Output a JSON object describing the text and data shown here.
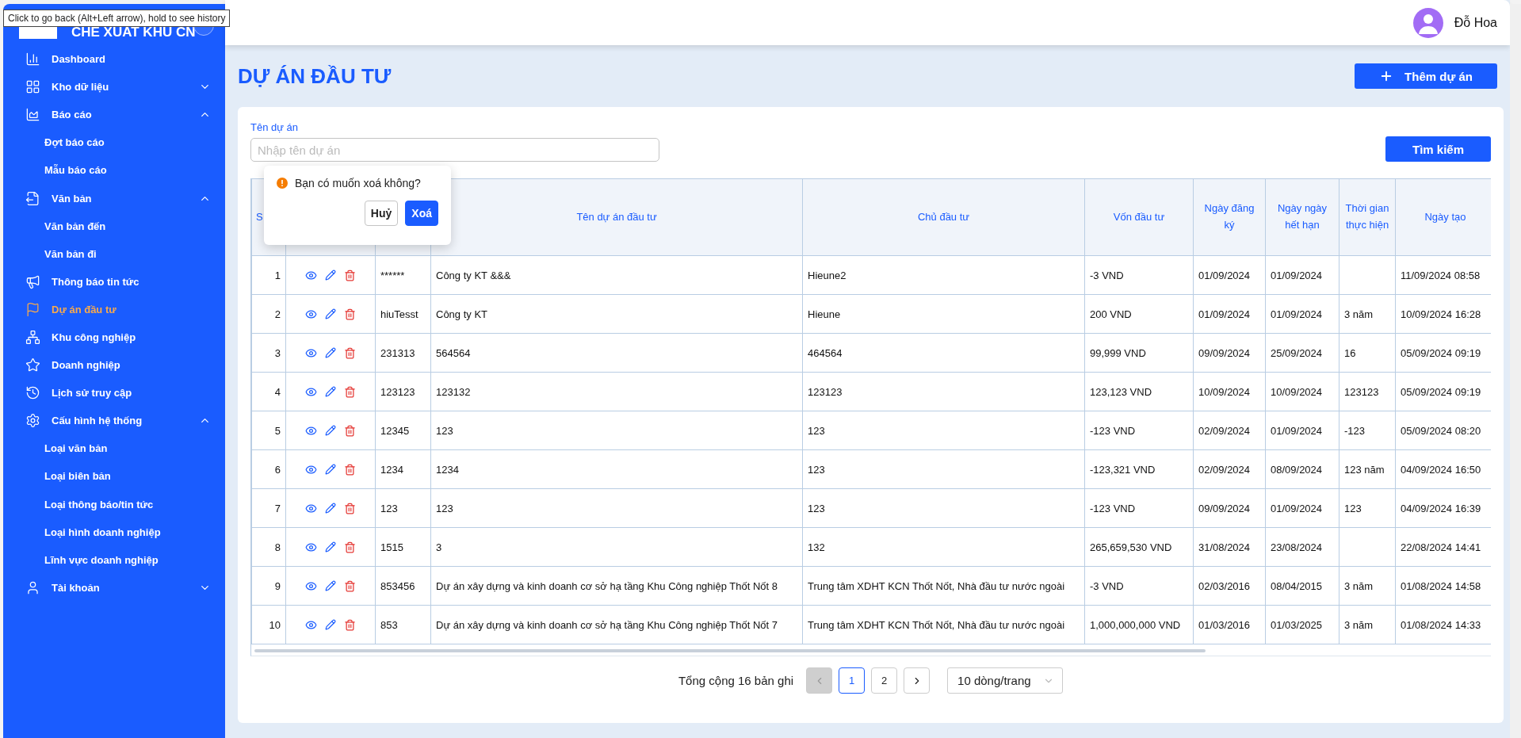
{
  "browser_tooltip": {
    "text": "Click to go back (Alt+Left arrow), hold to see history"
  },
  "sidebar": {
    "logo_text": "CHE XUAT KHU CN",
    "items": [
      {
        "label": "Dashboard",
        "selected": false
      },
      {
        "label": "Kho dữ liệu",
        "selected": false,
        "expanded": false
      },
      {
        "label": "Báo cáo",
        "selected": false,
        "expanded": true,
        "children": [
          {
            "label": "Đợt báo cáo",
            "selected": false
          },
          {
            "label": "Mẫu báo cáo",
            "selected": false
          }
        ]
      },
      {
        "label": "Văn bản",
        "selected": false,
        "expanded": true,
        "children": [
          {
            "label": "Văn bản đến",
            "selected": false
          },
          {
            "label": "Văn bản đi",
            "selected": false
          }
        ]
      },
      {
        "label": "Thông báo tin tức",
        "selected": false
      },
      {
        "label": "Dự án đầu tư",
        "selected": true
      },
      {
        "label": "Khu công nghiệp",
        "selected": false
      },
      {
        "label": "Doanh nghiệp",
        "selected": false
      },
      {
        "label": "Lịch sử truy cập",
        "selected": false
      },
      {
        "label": "Cấu hình hệ thống",
        "selected": false,
        "expanded": true,
        "children": [
          {
            "label": "Loại văn bản",
            "selected": false
          },
          {
            "label": "Loại biên bản",
            "selected": false
          },
          {
            "label": "Loại thông báo/tin tức",
            "selected": false
          },
          {
            "label": "Loại hình doanh nghiệp",
            "selected": false
          },
          {
            "label": "Lĩnh vực doanh nghiệp",
            "selected": false
          }
        ]
      },
      {
        "label": "Tài khoản",
        "selected": false,
        "expanded": false
      }
    ]
  },
  "header": {
    "user_name": "Đỗ Hoa"
  },
  "page": {
    "title": "DỰ ÁN ĐẦU TƯ",
    "add_button": "Thêm dự án"
  },
  "search": {
    "label": "Tên dự án",
    "placeholder": "Nhập tên dự án",
    "button": "Tìm kiếm"
  },
  "table": {
    "columns": [
      {
        "label": "S"
      },
      {},
      {},
      {
        "label": "Tên dự án đầu tư"
      },
      {
        "label": "Chủ đầu tư"
      },
      {
        "label": "Vốn đầu tư"
      },
      {
        "label": "Ngày đăng ký"
      },
      {
        "label": "Ngày ngày hết hạn"
      },
      {
        "label": "Thời gian thực hiện"
      },
      {
        "label": "Ngày tạo"
      }
    ],
    "rows": [
      {
        "stt": "1",
        "code": "******",
        "name": "Công ty KT &&&",
        "owner": "Hieune2",
        "capital": "-3 VND",
        "reg_date": "01/09/2024",
        "exp_date": "01/09/2024",
        "created": "11/09/2024 08:58"
      },
      {
        "stt": "2",
        "code": "hiuTesst",
        "name": "Công ty KT",
        "owner": "Hieune",
        "capital": "200 VND",
        "reg_date": "01/09/2024",
        "exp_date": "01/09/2024",
        "duration": "3 năm",
        "created": "10/09/2024 16:28"
      },
      {
        "stt": "3",
        "code": "231313",
        "name": "564564",
        "owner": "464564",
        "capital": "99,999 VND",
        "reg_date": "09/09/2024",
        "exp_date": "25/09/2024",
        "duration": "16",
        "created": "05/09/2024 09:19"
      },
      {
        "stt": "4",
        "code": "123123",
        "name": "123132",
        "owner": "123123",
        "capital": "123,123 VND",
        "reg_date": "10/09/2024",
        "exp_date": "10/09/2024",
        "duration": "123123",
        "created": "05/09/2024 09:19"
      },
      {
        "stt": "5",
        "code": "12345",
        "name": "123",
        "owner": "123",
        "capital": "-123 VND",
        "reg_date": "02/09/2024",
        "exp_date": "01/09/2024",
        "duration": "-123",
        "created": "05/09/2024 08:20"
      },
      {
        "stt": "6",
        "code": "1234",
        "name": "1234",
        "owner": "123",
        "capital": "-123,321 VND",
        "reg_date": "02/09/2024",
        "exp_date": "08/09/2024",
        "duration": "123 năm",
        "created": "04/09/2024 16:50"
      },
      {
        "stt": "7",
        "code": "123",
        "name": "123",
        "owner": "123",
        "capital": "-123 VND",
        "reg_date": "09/09/2024",
        "exp_date": "01/09/2024",
        "duration": "123",
        "created": "04/09/2024 16:39"
      },
      {
        "stt": "8",
        "code": "1515",
        "name": "3",
        "owner": "132",
        "capital": "265,659,530 VND",
        "reg_date": "31/08/2024",
        "exp_date": "23/08/2024",
        "created": "22/08/2024 14:41"
      },
      {
        "stt": "9",
        "code": "853456",
        "name": "Dự án xây dựng và kinh doanh cơ sở hạ tầng Khu Công nghiệp Thốt Nốt 8",
        "owner": "Trung tâm XDHT KCN Thốt Nốt, Nhà đầu tư nước ngoài",
        "capital": "-3 VND",
        "reg_date": "02/03/2016",
        "exp_date": "08/04/2015",
        "duration": "3 năm",
        "created": "01/08/2024 14:58"
      },
      {
        "stt": "10",
        "code": "853",
        "name": "Dự án xây dựng và kinh doanh cơ sở hạ tầng Khu Công nghiệp Thốt Nốt 7",
        "owner": "Trung tâm XDHT KCN Thốt Nốt, Nhà đầu tư nước ngoài",
        "capital": "1,000,000,000 VND",
        "reg_date": "01/03/2016",
        "exp_date": "01/03/2025",
        "duration": "3 năm",
        "created": "01/08/2024 14:33"
      }
    ]
  },
  "delete_popover": {
    "message": "Bạn có muốn xoá không?",
    "cancel": "Huỷ",
    "confirm": "Xoá"
  },
  "pagination": {
    "total": "Tổng cộng 16 bản ghi",
    "prev_disabled": true,
    "pages": [
      {
        "label": "1",
        "selected": true
      },
      {
        "label": "2",
        "selected": false
      }
    ],
    "page_size": "10 dòng/trang"
  }
}
